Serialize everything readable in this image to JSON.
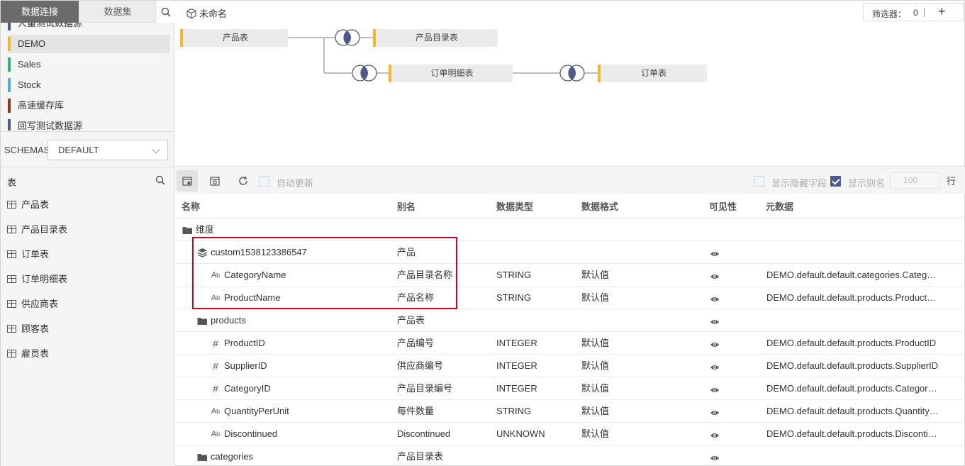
{
  "left": {
    "tabs": {
      "connection": "数据连接",
      "dataset": "数据集"
    },
    "sources": [
      {
        "label": "大量测试数据源",
        "color": "#4a5b8c"
      },
      {
        "label": "DEMO",
        "color": "#f2b632",
        "selected": true
      },
      {
        "label": "Sales",
        "color": "#2bb673"
      },
      {
        "label": "Stock",
        "color": "#5aa7e8"
      },
      {
        "label": "高速缓存库",
        "color": "#8b3a1a"
      },
      {
        "label": "回写测试数据源",
        "color": "#4a5b8c"
      }
    ],
    "schemas_label": "SCHEMAS",
    "schema_value": "DEFAULT",
    "tables_label": "表",
    "tables": [
      "产品表",
      "产品目录表",
      "订单表",
      "订单明细表",
      "供应商表",
      "顾客表",
      "雇员表"
    ]
  },
  "diagram": {
    "title": "未命名",
    "filter_label": "筛选器：",
    "filter_count": "0",
    "filter_sep": "|",
    "nodes": {
      "product": "产品表",
      "catalog": "产品目录表",
      "order_detail": "订单明细表",
      "order": "订单表"
    }
  },
  "toolbar": {
    "auto_update": "自动更新",
    "show_hidden": "显示隐藏字段",
    "show_alias": "显示别名",
    "rows_value": "100",
    "rows_unit": "行"
  },
  "grid": {
    "headers": {
      "name": "名称",
      "alias": "别名",
      "type": "数据类型",
      "format": "数据格式",
      "visibility": "可见性",
      "meta": "元数据"
    },
    "rows": [
      {
        "icon": "folder",
        "level": 0,
        "name": "维度",
        "alias": "",
        "type": "",
        "format": "",
        "eye": false,
        "meta": ""
      },
      {
        "icon": "layers",
        "level": 1,
        "name": "custom1538123386547",
        "alias": "产品",
        "type": "",
        "format": "",
        "eye": true,
        "meta": ""
      },
      {
        "icon": "text",
        "level": 2,
        "name": "CategoryName",
        "alias": "产品目录名称",
        "type": "STRING",
        "format": "默认值",
        "eye": true,
        "meta": "DEMO.default.default.categories.CategoryName"
      },
      {
        "icon": "text",
        "level": 2,
        "name": "ProductName",
        "alias": "产品名称",
        "type": "STRING",
        "format": "默认值",
        "eye": true,
        "meta": "DEMO.default.default.products.ProductName"
      },
      {
        "icon": "folder",
        "level": 1,
        "name": "products",
        "alias": "产品表",
        "type": "",
        "format": "",
        "eye": true,
        "meta": ""
      },
      {
        "icon": "hash",
        "level": 2,
        "name": "ProductID",
        "alias": "产品编号",
        "type": "INTEGER",
        "format": "默认值",
        "eye": true,
        "meta": "DEMO.default.default.products.ProductID"
      },
      {
        "icon": "hash",
        "level": 2,
        "name": "SupplierID",
        "alias": "供应商编号",
        "type": "INTEGER",
        "format": "默认值",
        "eye": true,
        "meta": "DEMO.default.default.products.SupplierID"
      },
      {
        "icon": "hash",
        "level": 2,
        "name": "CategoryID",
        "alias": "产品目录编号",
        "type": "INTEGER",
        "format": "默认值",
        "eye": true,
        "meta": "DEMO.default.default.products.CategoryID"
      },
      {
        "icon": "text",
        "level": 2,
        "name": "QuantityPerUnit",
        "alias": "每件数量",
        "type": "STRING",
        "format": "默认值",
        "eye": true,
        "meta": "DEMO.default.default.products.QuantityPerUnit"
      },
      {
        "icon": "text",
        "level": 2,
        "name": "Discontinued",
        "alias": "Discontinued",
        "type": "UNKNOWN",
        "format": "默认值",
        "eye": true,
        "meta": "DEMO.default.default.products.Discontinued"
      },
      {
        "icon": "folder",
        "level": 1,
        "name": "categories",
        "alias": "产品目录表",
        "type": "",
        "format": "",
        "eye": true,
        "meta": ""
      }
    ]
  }
}
